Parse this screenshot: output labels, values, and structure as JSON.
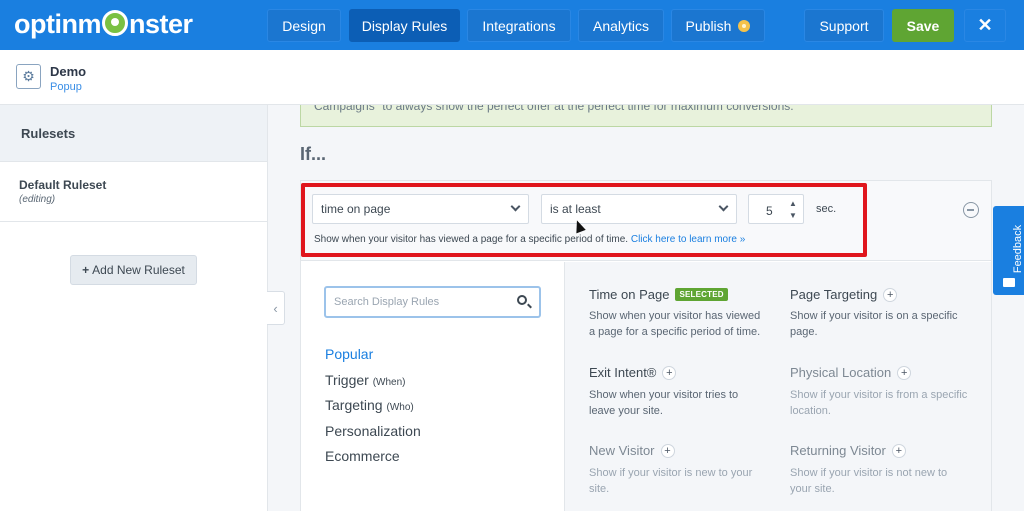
{
  "brand": {
    "logo_text_left": "optinm",
    "logo_text_right": "nster"
  },
  "nav": {
    "design": "Design",
    "display_rules": "Display Rules",
    "integrations": "Integrations",
    "analytics": "Analytics",
    "publish": "Publish",
    "support": "Support",
    "save": "Save",
    "close": "✕"
  },
  "campaign": {
    "name": "Demo",
    "type": "Popup"
  },
  "sidebar": {
    "heading": "Rulesets",
    "ruleset_name": "Default Ruleset",
    "ruleset_state": "(editing)",
    "add_button": "Add New Ruleset",
    "collapse": "‹"
  },
  "notice_text": "Campaigns\" to always show the perfect offer at the perfect time for maximum conversions.",
  "if_label": "If...",
  "rule": {
    "condition": "time on page",
    "operator": "is at least",
    "value": "5",
    "unit": "sec.",
    "help_text": "Show when your visitor has viewed a page for a specific period of time.",
    "help_link": "Click here to learn more »"
  },
  "picker": {
    "search_placeholder": "Search Display Rules",
    "categories": [
      {
        "label": "Popular",
        "sub": ""
      },
      {
        "label": "Trigger",
        "sub": "(When)"
      },
      {
        "label": "Targeting",
        "sub": "(Who)"
      },
      {
        "label": "Personalization",
        "sub": ""
      },
      {
        "label": "Ecommerce",
        "sub": ""
      }
    ],
    "rules": [
      {
        "title": "Time on Page",
        "badge": "SELECTED",
        "desc": "Show when your visitor has viewed a page for a specific period of time."
      },
      {
        "title": "Page Targeting",
        "badge": "",
        "desc": "Show if your visitor is on a specific page."
      },
      {
        "title": "Exit Intent®",
        "badge": "",
        "desc": "Show when your visitor tries to leave your site."
      },
      {
        "title": "Physical Location",
        "badge": "",
        "desc": "Show if your visitor is from a specific location."
      },
      {
        "title": "New Visitor",
        "badge": "",
        "desc": "Show if your visitor is new to your site."
      },
      {
        "title": "Returning Visitor",
        "badge": "",
        "desc": "Show if your visitor is not new to your site."
      }
    ]
  },
  "feedback": "Feedback",
  "colors": {
    "brand_blue": "#1a7fe0",
    "save_green": "#5fa533",
    "highlight_red": "#e0161d"
  }
}
